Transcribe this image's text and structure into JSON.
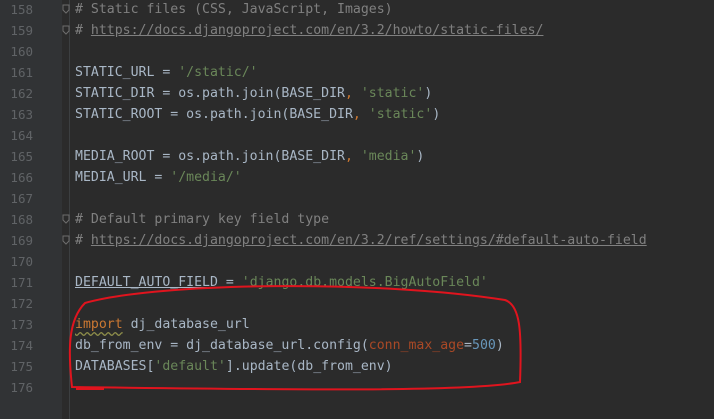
{
  "editor": {
    "lines": [
      {
        "num": "158",
        "fold": true,
        "tokens": [
          {
            "t": "comment",
            "v": "# Static files (CSS, JavaScript, Images)"
          }
        ]
      },
      {
        "num": "159",
        "fold": true,
        "tokens": [
          {
            "t": "comment",
            "v": "# "
          },
          {
            "t": "link",
            "v": "https://docs.djangoproject.com/en/3.2/howto/static-files/"
          }
        ]
      },
      {
        "num": "160",
        "tokens": []
      },
      {
        "num": "161",
        "tokens": [
          {
            "t": "plain",
            "v": "STATIC_URL = "
          },
          {
            "t": "string",
            "v": "'/static/'"
          }
        ]
      },
      {
        "num": "162",
        "tokens": [
          {
            "t": "plain",
            "v": "STATIC_DIR = os.path.join(BASE_DIR"
          },
          {
            "t": "op",
            "v": ", "
          },
          {
            "t": "string",
            "v": "'static'"
          },
          {
            "t": "plain",
            "v": ")"
          }
        ]
      },
      {
        "num": "163",
        "tokens": [
          {
            "t": "plain",
            "v": "STATIC_ROOT = os.path.join(BASE_DIR"
          },
          {
            "t": "op",
            "v": ", "
          },
          {
            "t": "string",
            "v": "'static'"
          },
          {
            "t": "plain",
            "v": ")"
          }
        ]
      },
      {
        "num": "164",
        "tokens": []
      },
      {
        "num": "165",
        "tokens": [
          {
            "t": "plain",
            "v": "MEDIA_ROOT = os.path.join(BASE_DIR"
          },
          {
            "t": "op",
            "v": ", "
          },
          {
            "t": "string",
            "v": "'media'"
          },
          {
            "t": "plain",
            "v": ")"
          }
        ]
      },
      {
        "num": "166",
        "tokens": [
          {
            "t": "plain",
            "v": "MEDIA_URL = "
          },
          {
            "t": "string",
            "v": "'/media/'"
          }
        ]
      },
      {
        "num": "167",
        "tokens": []
      },
      {
        "num": "168",
        "fold": true,
        "tokens": [
          {
            "t": "comment",
            "v": "# Default primary key field type"
          }
        ]
      },
      {
        "num": "169",
        "fold": true,
        "tokens": [
          {
            "t": "comment",
            "v": "# "
          },
          {
            "t": "link",
            "v": "https://docs.djangoproject.com/en/3.2/ref/settings/#default-auto-field"
          }
        ]
      },
      {
        "num": "170",
        "tokens": []
      },
      {
        "num": "171",
        "tokens": [
          {
            "t": "strike",
            "v": "DEFAULT_AUTO_FIELD"
          },
          {
            "t": "plain",
            "v": " = "
          },
          {
            "t": "string",
            "v": "'django.db.models.BigAutoField'"
          }
        ]
      },
      {
        "num": "172",
        "tokens": []
      },
      {
        "num": "173",
        "tokens": [
          {
            "t": "keyword",
            "v": "import"
          },
          {
            "t": "plain",
            "v": " dj_database_url"
          }
        ]
      },
      {
        "num": "174",
        "tokens": [
          {
            "t": "plain",
            "v": "db_from_env = dj_database_url.config("
          },
          {
            "t": "param",
            "v": "conn_max_age"
          },
          {
            "t": "plain",
            "v": "="
          },
          {
            "t": "number",
            "v": "500"
          },
          {
            "t": "plain",
            "v": ")"
          }
        ]
      },
      {
        "num": "175",
        "tokens": [
          {
            "t": "plain",
            "v": "DATABASES["
          },
          {
            "t": "string",
            "v": "'default'"
          },
          {
            "t": "plain",
            "v": "].update(db_from_env)"
          }
        ]
      },
      {
        "num": "176",
        "tokens": []
      }
    ]
  },
  "colors": {
    "background": "#2b2b2b",
    "annotation": "#e0141e"
  }
}
